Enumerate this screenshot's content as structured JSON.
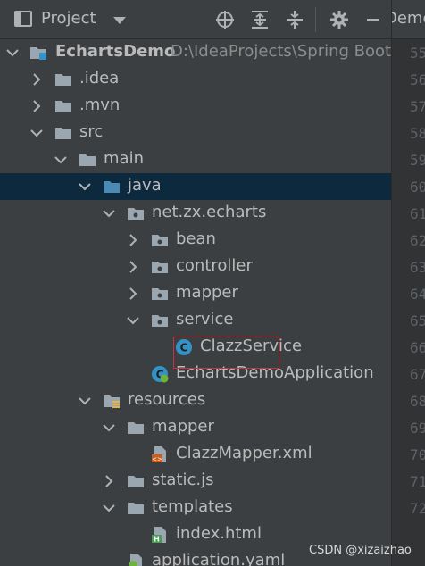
{
  "header": {
    "title": "Project",
    "icons": [
      "project-view-icon",
      "dropdown-arrow-icon",
      "locate-icon",
      "expand-all-icon",
      "collapse-all-icon",
      "gear-icon",
      "minimize-icon"
    ]
  },
  "editor": {
    "tab_label": "Demo",
    "line_numbers": [
      "55",
      "56",
      "57",
      "58",
      "59",
      "60",
      "61",
      "62",
      "63",
      "64",
      "65",
      "66",
      "67",
      "68",
      "69",
      "70",
      "71",
      "72"
    ]
  },
  "tree": {
    "root": {
      "label": "EchartsDemo",
      "path": "D:\\IdeaProjects\\Spring Boot\\"
    },
    "items": [
      {
        "label": ".idea"
      },
      {
        "label": ".mvn"
      },
      {
        "label": "src"
      },
      {
        "label": "main"
      },
      {
        "label": "java"
      },
      {
        "label": "net.zx.echarts"
      },
      {
        "label": "bean"
      },
      {
        "label": "controller"
      },
      {
        "label": "mapper"
      },
      {
        "label": "service"
      },
      {
        "label": "ClazzService"
      },
      {
        "label": "EchartsDemoApplication"
      },
      {
        "label": "resources"
      },
      {
        "label": "mapper"
      },
      {
        "label": "ClazzMapper.xml"
      },
      {
        "label": "static.js"
      },
      {
        "label": "templates"
      },
      {
        "label": "index.html"
      },
      {
        "label": "application.yaml"
      }
    ]
  },
  "watermark": "CSDN @xizaizhao",
  "colors": {
    "background": "#3c3f41",
    "selection": "#0d293e",
    "text": "#bbbbbb",
    "folder": "#9aa7b0",
    "java_folder": "#4a8ab5",
    "class_icon": "#3592c4",
    "highlight_border": "#c4343a"
  }
}
